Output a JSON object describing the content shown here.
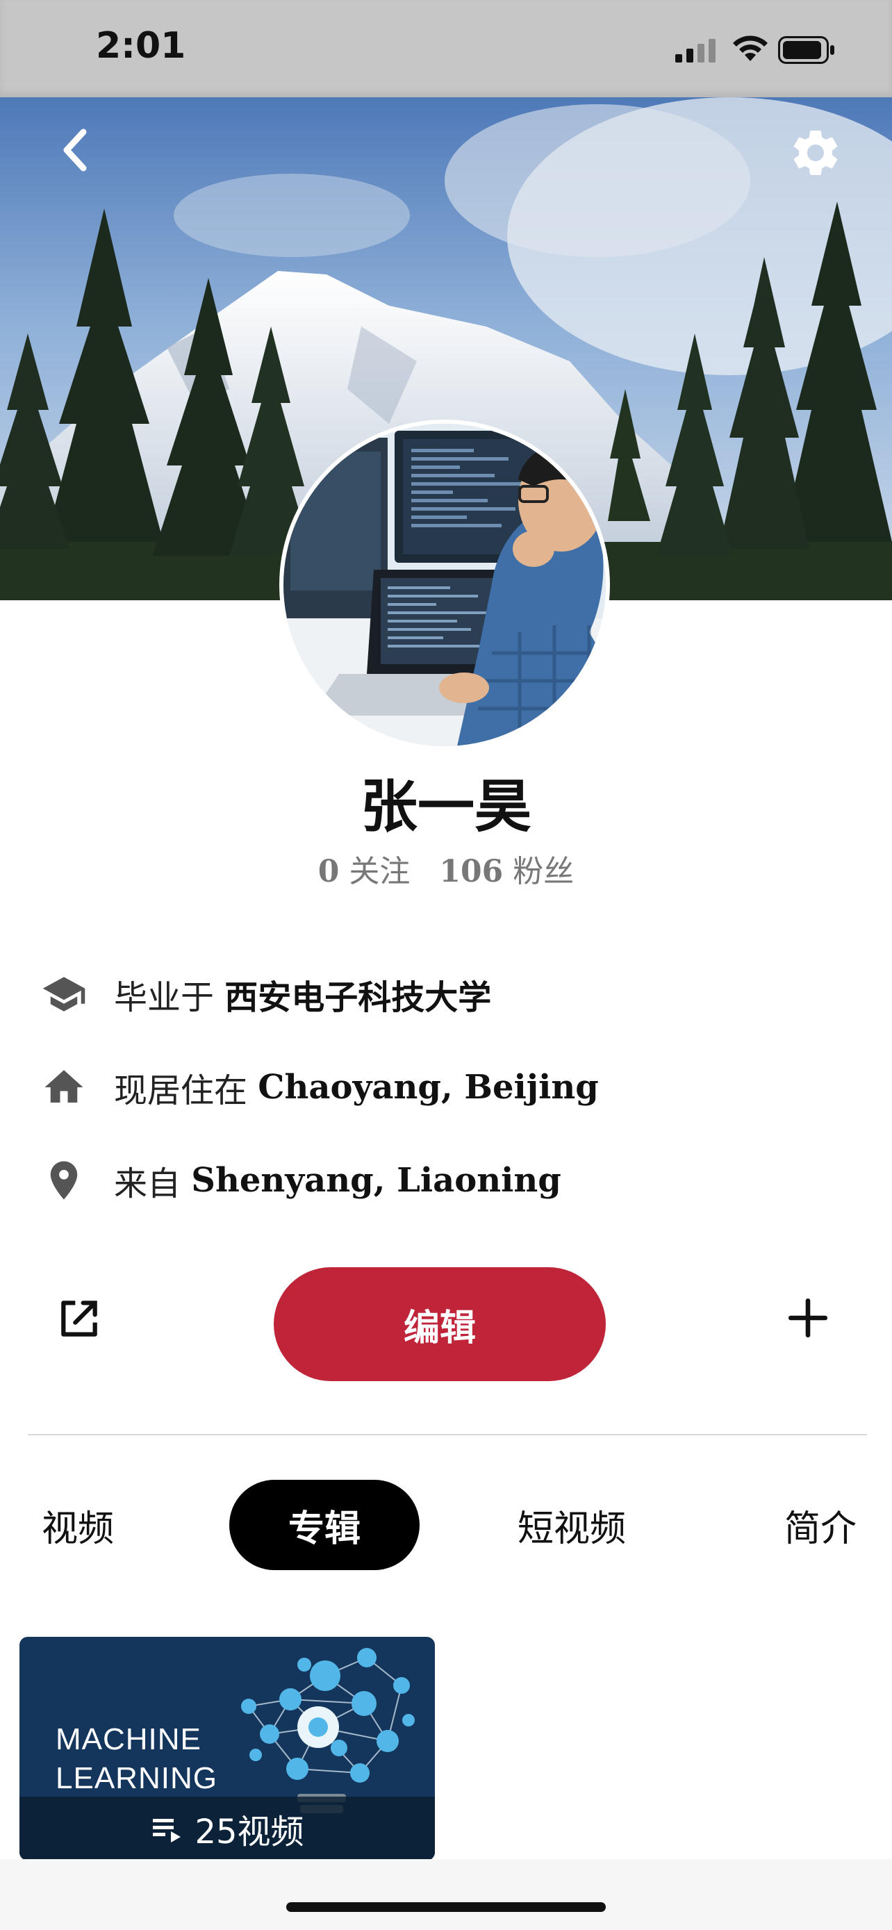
{
  "status_bar": {
    "time": "2:01"
  },
  "profile": {
    "name": "张一昊",
    "following_count": "0",
    "following_label": "关注",
    "followers_count": "106",
    "followers_label": "粉丝"
  },
  "info": {
    "education_prefix": "毕业于",
    "education_value": "西安电子科技大学",
    "residence_prefix": "现居住在",
    "residence_value": "Chaoyang, Beijing",
    "origin_prefix": "来自",
    "origin_value": "Shenyang, Liaoning"
  },
  "actions": {
    "edit_label": "编辑"
  },
  "tabs": [
    {
      "label": "视频",
      "active": false
    },
    {
      "label": "专辑",
      "active": true
    },
    {
      "label": "短视频",
      "active": false
    },
    {
      "label": "简介",
      "active": false
    }
  ],
  "albums": [
    {
      "title_line1": "MACHINE",
      "title_line2": "LEARNING",
      "video_count": "25视频"
    }
  ],
  "colors": {
    "accent": "#bf2439",
    "status_bar_bg": "#c6c6c6",
    "album_bg": "#15365c"
  },
  "icons": [
    "back-icon",
    "gear-icon",
    "graduation-cap-icon",
    "home-icon",
    "location-pin-icon",
    "share-icon",
    "plus-icon",
    "playlist-icon"
  ]
}
